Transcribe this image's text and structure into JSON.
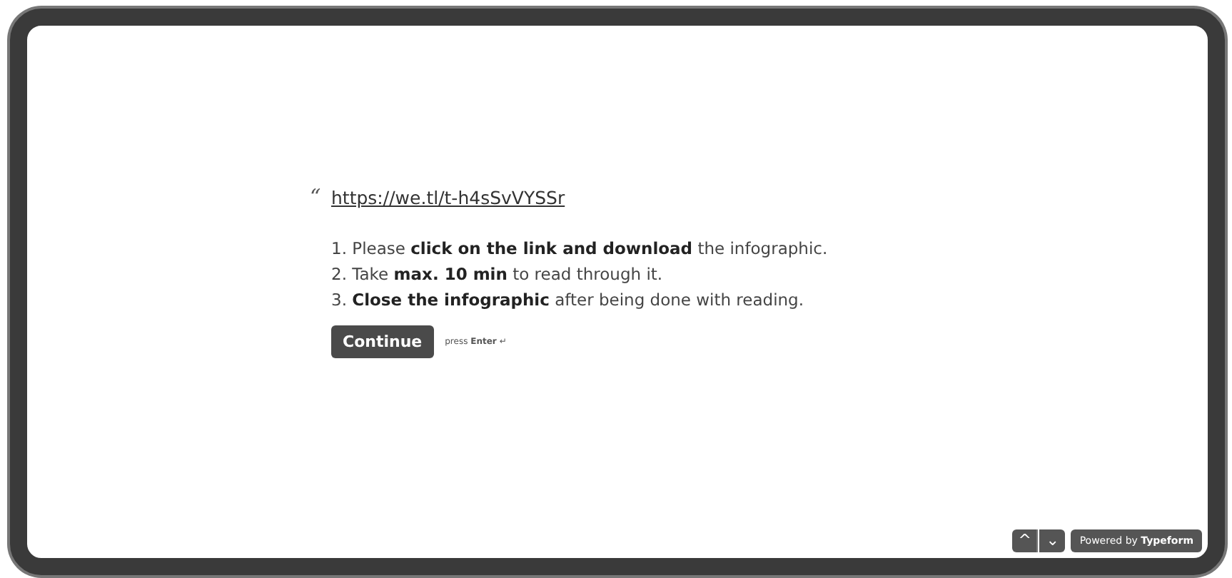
{
  "question": {
    "quote_mark": "“",
    "link": "https://we.tl/t-h4sSvVYSSr",
    "instructions": [
      "1. Please **click on the link and download** the infographic.",
      "2. Take **max. 10 min** to read through it.",
      "3. **Close the infographic** after being done with reading."
    ],
    "button": "Continue",
    "hint": "press **Enter** ↵"
  },
  "footer": {
    "nav_up": "^",
    "nav_down": "⌄",
    "powered_by": "Powered by **Typeform**"
  }
}
